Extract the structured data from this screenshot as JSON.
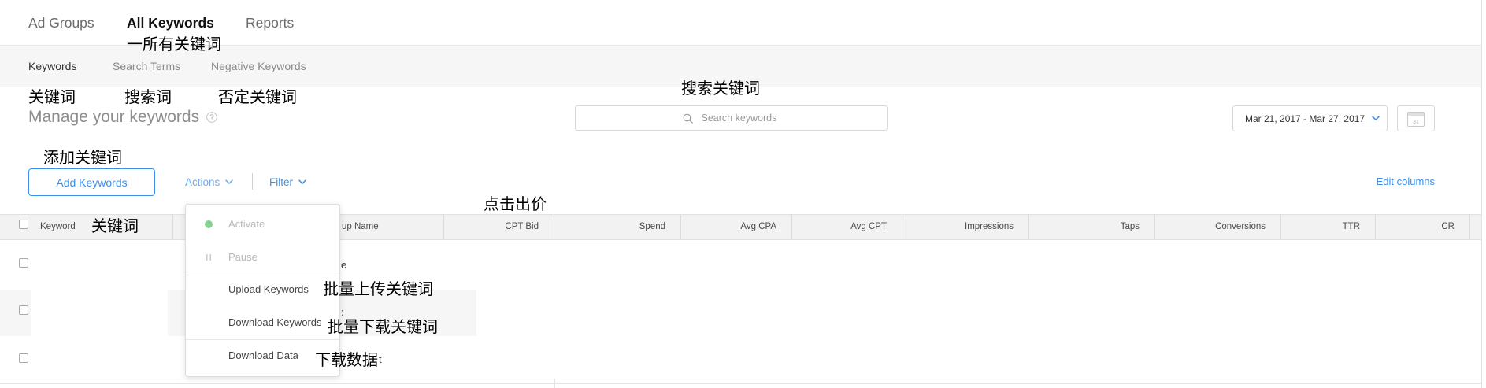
{
  "top_tabs": [
    {
      "label": "Ad Groups",
      "active": false
    },
    {
      "label": "All Keywords",
      "active": true
    },
    {
      "label": "Reports",
      "active": false
    }
  ],
  "sub_tabs": [
    {
      "label": "Keywords",
      "active": true
    },
    {
      "label": "Search Terms",
      "active": false
    },
    {
      "label": "Negative Keywords",
      "active": false
    }
  ],
  "page": {
    "title": "Manage your keywords",
    "help_icon": "question-circle-icon"
  },
  "search": {
    "placeholder": "Search keywords",
    "icon": "search-icon"
  },
  "date_range": {
    "label": "Mar 21, 2017 - Mar 27, 2017",
    "icon": "chevron-down-icon"
  },
  "calendar": {
    "icon": "calendar-icon",
    "day": "31"
  },
  "toolbar": {
    "add_keywords": "Add Keywords",
    "actions": "Actions",
    "actions_icon": "chevron-down-icon",
    "filter": "Filter",
    "filter_icon": "chevron-down-icon",
    "edit_columns": "Edit columns"
  },
  "actions_menu": {
    "open": true,
    "items": [
      {
        "label": "Activate",
        "icon": "status-dot-icon",
        "disabled": true
      },
      {
        "label": "Pause",
        "icon": "pause-icon",
        "disabled": true
      },
      {
        "label": "Upload Keywords",
        "disabled": false
      },
      {
        "label": "Download Keywords",
        "disabled": false
      },
      {
        "label": "Download Data",
        "disabled": false
      }
    ]
  },
  "table": {
    "columns": [
      "Keyword",
      "up Name",
      "CPT Bid",
      "Spend",
      "Avg CPA",
      "Avg CPT",
      "Impressions",
      "Taps",
      "Conversions",
      "TTR",
      "CR"
    ],
    "rows": [
      {
        "selected": false,
        "visible_text": "e"
      },
      {
        "selected": false,
        "visible_text": ":"
      },
      {
        "selected": false,
        "visible_text": "t"
      }
    ]
  },
  "annotations": {
    "all_keywords": "一所有关键词",
    "keywords": "关键词",
    "search_terms": "搜索词",
    "negative_keywords": "否定关键词",
    "search_keywords": "搜索关键词",
    "add_keywords": "添加关键词",
    "click_bid": "点击出价",
    "keyword_column": "关键词",
    "upload_keywords": "批量上传关键词",
    "download_keywords": "批量下载关键词",
    "download_data": "下载数据"
  },
  "colors": {
    "accent": "#3d8fe6",
    "accent_light": "#72acee",
    "activate_dot": "#86d38f"
  }
}
